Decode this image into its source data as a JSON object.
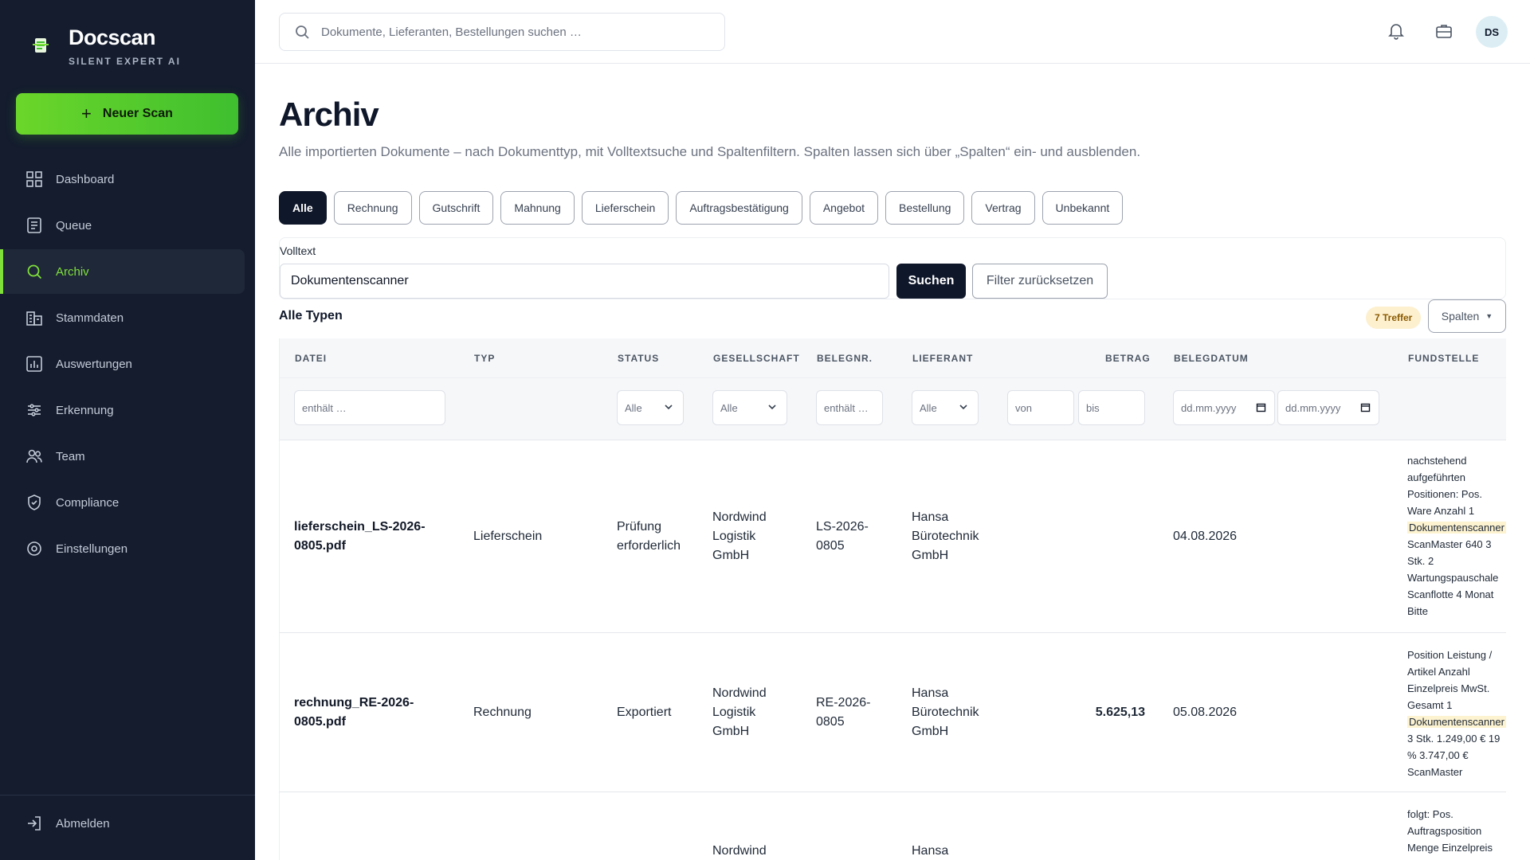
{
  "brand": {
    "name": "Docscan",
    "tagline": "SILENT EXPERT AI"
  },
  "new_scan_label": "Neuer Scan",
  "nav": [
    {
      "label": "Dashboard",
      "icon": "grid-icon"
    },
    {
      "label": "Queue",
      "icon": "list-icon"
    },
    {
      "label": "Archiv",
      "icon": "search-icon",
      "active": true
    },
    {
      "label": "Stammdaten",
      "icon": "building-icon"
    },
    {
      "label": "Auswertungen",
      "icon": "chart-icon"
    },
    {
      "label": "Erkennung",
      "icon": "sliders-icon"
    },
    {
      "label": "Team",
      "icon": "users-icon"
    },
    {
      "label": "Compliance",
      "icon": "shield-icon"
    },
    {
      "label": "Einstellungen",
      "icon": "gear-icon"
    }
  ],
  "logout_label": "Abmelden",
  "topbar": {
    "search_placeholder": "Dokumente, Lieferanten, Bestellungen suchen …",
    "avatar_initials": "DS"
  },
  "page": {
    "title": "Archiv",
    "description": "Alle importierten Dokumente – nach Dokumenttyp, mit Volltextsuche und Spaltenfiltern. Spalten lassen sich über „Spalten“ ein- und ausblenden."
  },
  "type_filters": [
    "Alle",
    "Rechnung",
    "Gutschrift",
    "Mahnung",
    "Lieferschein",
    "Auftragsbestätigung",
    "Angebot",
    "Bestellung",
    "Vertrag",
    "Unbekannt"
  ],
  "fulltext": {
    "label": "Volltext",
    "value": "Dokumentenscanner",
    "search_button": "Suchen",
    "reset_button": "Filter zurücksetzen"
  },
  "section": {
    "title": "Alle Typen",
    "hits": "7 Treffer",
    "columns_button": "Spalten"
  },
  "table": {
    "headers": {
      "datei": "DATEI",
      "typ": "TYP",
      "status": "STATUS",
      "gesellschaft": "GESELLSCHAFT",
      "belegnr": "BELEGNR.",
      "lieferant": "LIEFERANT",
      "betrag": "BETRAG",
      "belegdatum": "BELEGDATUM",
      "fundstelle": "FUNDSTELLE"
    },
    "filters": {
      "datei_placeholder": "enthält …",
      "status": "Alle",
      "gesellschaft": "Alle",
      "belegnr_placeholder": "enthält …",
      "lieferant": "Alle",
      "betrag_from": "von",
      "betrag_to": "bis",
      "date_from": "dd.mm.yyyy",
      "date_to": "dd.mm.yyyy"
    },
    "rows": [
      {
        "datei": "lieferschein_LS-2026-\n0805.pdf",
        "typ": "Lieferschein",
        "status": "Prüfung\nerforderlich",
        "gesellschaft": "Nordwind\nLogistik\nGmbH",
        "belegnr": "LS-2026-\n0805",
        "lieferant": "Hansa\nBürotechnik\nGmbH",
        "betrag": "",
        "belegdatum": "04.08.2026",
        "fundstelle_before": "nachstehend aufgeführten Positionen: Pos. Ware Anzahl 1",
        "fundstelle_hit": "Dokumentenscanner",
        "fundstelle_after": "ScanMaster 640 3 Stk. 2 Wartungspauschale Scanflotte 4 Monat Bitte"
      },
      {
        "datei": "rechnung_RE-2026-\n0805.pdf",
        "typ": "Rechnung",
        "status": "Exportiert",
        "gesellschaft": "Nordwind\nLogistik\nGmbH",
        "belegnr": "RE-2026-\n0805",
        "lieferant": "Hansa\nBürotechnik\nGmbH",
        "betrag": "5.625,13",
        "belegdatum": "05.08.2026",
        "fundstelle_before": "Position Leistung / Artikel Anzahl Einzelpreis MwSt. Gesamt 1",
        "fundstelle_hit": "Dokumentenscanner",
        "fundstelle_after": "3 Stk. 1.249,00 € 19 % 3.747,00 € ScanMaster"
      },
      {
        "datei": "",
        "typ": "",
        "status": "",
        "gesellschaft": "Nordwind",
        "belegnr": "",
        "lieferant": "Hansa",
        "betrag": "",
        "belegdatum": "",
        "fundstelle_before": "folgt: Pos. Auftragsposition Menge Einzelpreis",
        "fundstelle_hit": "",
        "fundstelle_after": ""
      }
    ]
  }
}
